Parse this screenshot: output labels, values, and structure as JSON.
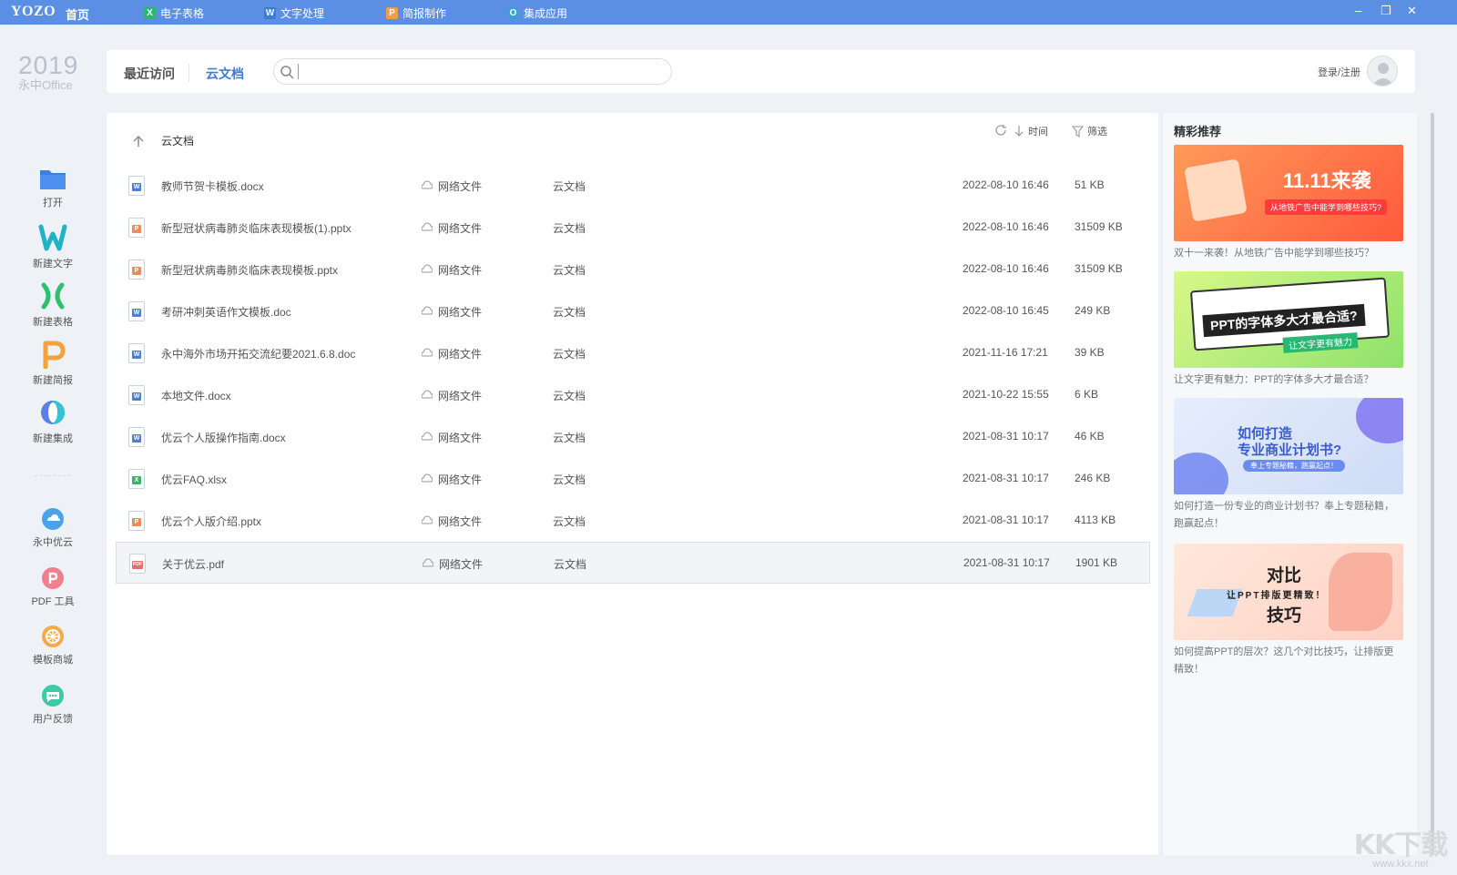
{
  "titlebar": {
    "logo": "YOZO",
    "home": "首页",
    "apps": [
      {
        "label": "电子表格",
        "icon": "X",
        "color": "#2bb673"
      },
      {
        "label": "文字处理",
        "icon": "W",
        "color": "#3a7bd5"
      },
      {
        "label": "简报制作",
        "icon": "P",
        "color": "#f39c4a"
      },
      {
        "label": "集成应用",
        "icon": "O",
        "color": "#34a3d8"
      }
    ],
    "min": "–",
    "restore": "❐",
    "close": "✕"
  },
  "sidebar": {
    "year": "2019",
    "product": "永中Office",
    "items": [
      {
        "label": "打开"
      },
      {
        "label": "新建文字"
      },
      {
        "label": "新建表格"
      },
      {
        "label": "新建简报"
      },
      {
        "label": "新建集成"
      },
      {
        "label": "永中优云"
      },
      {
        "label": "PDF 工具"
      },
      {
        "label": "模板商城"
      },
      {
        "label": "用户反馈"
      }
    ]
  },
  "header": {
    "tab_recent": "最近访问",
    "tab_cloud": "云文档",
    "search_placeholder": "",
    "login": "登录/注册"
  },
  "toolbar": {
    "sort_label": "时间",
    "filter_label": "筛选"
  },
  "breadcrumb": {
    "current": "云文档"
  },
  "files": [
    {
      "name": "教师节贺卡模板.docx",
      "kind": "word",
      "type": "网络文件",
      "location": "云文档",
      "time": "2022-08-10 16:46",
      "size": "51 KB"
    },
    {
      "name": "新型冠状病毒肺炎临床表现模板(1).pptx",
      "kind": "ppt",
      "type": "网络文件",
      "location": "云文档",
      "time": "2022-08-10 16:46",
      "size": "31509 KB"
    },
    {
      "name": "新型冠状病毒肺炎临床表现模板.pptx",
      "kind": "ppt",
      "type": "网络文件",
      "location": "云文档",
      "time": "2022-08-10 16:46",
      "size": "31509 KB"
    },
    {
      "name": "考研冲刺英语作文模板.doc",
      "kind": "word",
      "type": "网络文件",
      "location": "云文档",
      "time": "2022-08-10 16:45",
      "size": "249 KB"
    },
    {
      "name": "永中海外市场开拓交流纪要2021.6.8.doc",
      "kind": "word",
      "type": "网络文件",
      "location": "云文档",
      "time": "2021-11-16 17:21",
      "size": "39 KB"
    },
    {
      "name": "本地文件.docx",
      "kind": "word",
      "type": "网络文件",
      "location": "云文档",
      "time": "2021-10-22 15:55",
      "size": "6 KB"
    },
    {
      "name": "优云个人版操作指南.docx",
      "kind": "word",
      "type": "网络文件",
      "location": "云文档",
      "time": "2021-08-31 10:17",
      "size": "46 KB"
    },
    {
      "name": "优云FAQ.xlsx",
      "kind": "excel",
      "type": "网络文件",
      "location": "云文档",
      "time": "2021-08-31 10:17",
      "size": "246 KB"
    },
    {
      "name": "优云个人版介绍.pptx",
      "kind": "ppt",
      "type": "网络文件",
      "location": "云文档",
      "time": "2021-08-31 10:17",
      "size": "4113 KB"
    },
    {
      "name": "关于优云.pdf",
      "kind": "pdf",
      "type": "网络文件",
      "location": "云文档",
      "time": "2021-08-31 10:17",
      "size": "1901 KB"
    }
  ],
  "recommend": {
    "title": "精彩推荐",
    "cards": [
      {
        "banner_big": "11.11来袭",
        "banner_small": "从地铁广告中能学到哪些技巧?",
        "caption": "双十一来袭！从地铁广告中能学到哪些技巧？"
      },
      {
        "banner_big": "PPT的字体多大才最合适?",
        "banner_small": "让文字更有魅力",
        "caption": "让文字更有魅力：PPT的字体多大才最合适？"
      },
      {
        "banner_big": "如何打造",
        "banner_big2": "专业商业计划书?",
        "banner_small": "奉上专题秘籍，跑赢起点！",
        "caption": "如何打造一份专业的商业计划书？奉上专题秘籍，跑赢起点！"
      },
      {
        "banner_big": "对比",
        "banner_mid": "让PPT排版更精致！",
        "banner_big2": "技巧",
        "caption": "如何提高PPT的层次？这几个对比技巧，让排版更精致！"
      }
    ]
  },
  "watermark": {
    "big": "KK下载",
    "small": "www.kkx.net"
  },
  "colors": {
    "accent": "#5b8fe4",
    "link": "#3f7ad9",
    "word": "#4a7fd8",
    "ppt": "#ef8a5a",
    "excel": "#3db06e",
    "pdf": "#e46d6d"
  }
}
